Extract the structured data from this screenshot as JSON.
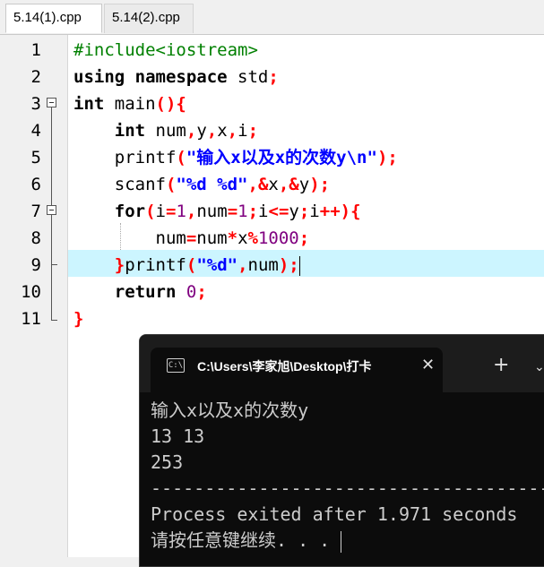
{
  "tabs": [
    {
      "label": "5.14(1).cpp",
      "active": true
    },
    {
      "label": "5.14(2).cpp",
      "active": false
    }
  ],
  "line_numbers": [
    "1",
    "2",
    "3",
    "4",
    "5",
    "6",
    "7",
    "8",
    "9",
    "10",
    "11"
  ],
  "code": {
    "l1": {
      "pp": "#include<iostream>"
    },
    "l2": {
      "kw1": "using",
      "sp": " ",
      "kw2": "namespace",
      "id": " std",
      "semi": ";"
    },
    "l3": {
      "kw": "int",
      "id": " main",
      "sym": "(){"
    },
    "l4": {
      "indent": "    ",
      "kw": "int",
      "id": " num",
      "c1": ",",
      "y": "y",
      "c2": ",",
      "x": "x",
      "c3": ",",
      "i": "i",
      "semi": ";"
    },
    "l5": {
      "indent": "    ",
      "fn": "printf",
      "p1": "(",
      "str": "\"输入x以及x的次数y\\n\"",
      "p2": ");"
    },
    "l6": {
      "indent": "    ",
      "fn": "scanf",
      "p1": "(",
      "str": "\"%d %d\"",
      "c1": ",&",
      "x": "x",
      "c2": ",&",
      "y": "y",
      "p2": ");"
    },
    "l7": {
      "indent": "    ",
      "kw": "for",
      "p1": "(",
      "a": "i",
      "eq": "=",
      "n1": "1",
      "c1": ",",
      "b": "num",
      "eq2": "=",
      "n2": "1",
      "s1": ";",
      "c": "i",
      "le": "<=",
      "d": "y",
      "s2": ";",
      "e": "i",
      "inc": "++){"
    },
    "l8": {
      "indent": "        ",
      "a": "num",
      "eq": "=",
      "b": "num",
      "mul": "*",
      "c": "x",
      "mod": "%",
      "n": "1000",
      "semi": ";"
    },
    "l9": {
      "indent": "    ",
      "br": "}",
      "fn": "printf",
      "p1": "(",
      "str": "\"%d\"",
      "c1": ",",
      "a": "num",
      "p2": ");"
    },
    "l10": {
      "indent": "    ",
      "kw": "return",
      "sp": " ",
      "n": "0",
      "semi": ";"
    },
    "l11": {
      "br": "}"
    }
  },
  "terminal": {
    "icon": "C:\\",
    "title": "C:\\Users\\李家旭\\Desktop\\打卡",
    "close": "✕",
    "plus": "+",
    "chevron": "⌄",
    "lines": [
      "输入x以及x的次数y",
      "13 13",
      "253",
      "--------------------------------------------",
      "Process exited after 1.971 seconds",
      "请按任意键继续. . . "
    ]
  },
  "colors": {
    "keyword": "#000000",
    "preprocessor": "#008000",
    "symbol": "#ff0000",
    "string": "#0000ff",
    "number": "#800080",
    "current_line": "#ccf5ff",
    "terminal_bg": "#0c0c0c"
  }
}
